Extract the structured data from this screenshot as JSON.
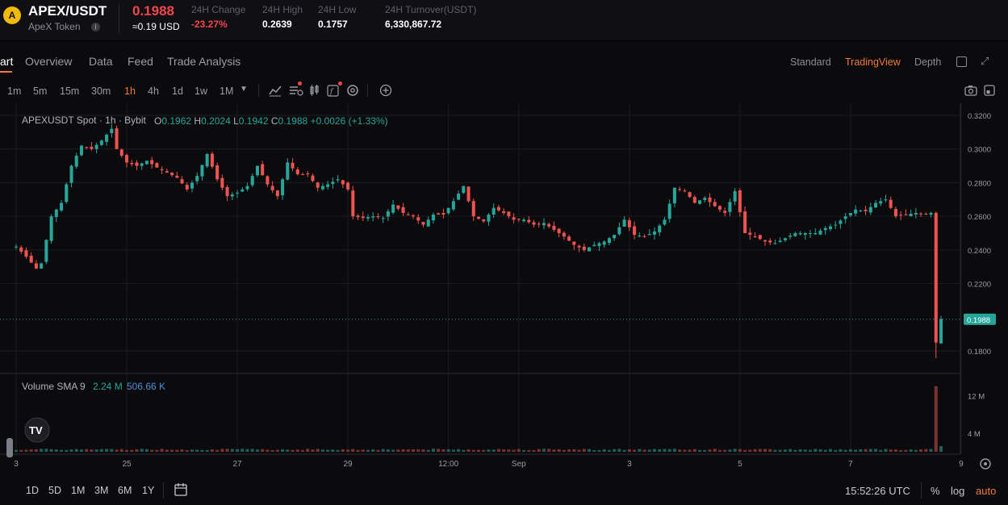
{
  "ticker": {
    "logo_glyph": "A",
    "pair": "APEX/USDT",
    "token_name": "ApeX Token",
    "info_glyph": "i",
    "price": "0.1988",
    "price_usd": "≈0.19 USD",
    "stats": [
      {
        "label": "24H Change",
        "value": "-23.27%",
        "negative": true
      },
      {
        "label": "24H High",
        "value": "0.2639",
        "negative": false
      },
      {
        "label": "24H Low",
        "value": "0.1757",
        "negative": false
      },
      {
        "label": "24H Turnover(USDT)",
        "value": "6,330,867.72",
        "negative": false
      }
    ]
  },
  "tabs": [
    "art",
    "Overview",
    "Data",
    "Feed",
    "Trade Analysis"
  ],
  "views": [
    "Standard",
    "TradingView",
    "Depth"
  ],
  "active_view": "TradingView",
  "timeframes": [
    "1m",
    "5m",
    "15m",
    "30m",
    "1h",
    "4h",
    "1d",
    "1w",
    "1M"
  ],
  "active_timeframe": "1h",
  "toolbar_icons": [
    "indicators-icon",
    "compare-icon",
    "candle-type-icon",
    "function-icon",
    "settings-icon",
    "add-icon",
    "camera-icon",
    "fullscreen-icon"
  ],
  "legend": {
    "symbol": "APEXUSDT Spot · 1h · Bybit",
    "o_label": "O",
    "o": "0.1962",
    "h_label": "H",
    "h": "0.2024",
    "l_label": "L",
    "l": "0.1942",
    "c_label": "C",
    "c": "0.1988",
    "change": "+0.0026 (+1.33%)"
  },
  "volume_legend": {
    "label": "Volume SMA 9",
    "v1": "2.24 M",
    "v2": "506.66 K"
  },
  "colors": {
    "up": "#26a69a",
    "down": "#ef5350",
    "accent": "#f07a3a",
    "grid": "#1c1c22",
    "price_tag": "#26a69a",
    "volume_sma": "#4a90d9"
  },
  "bottom": {
    "ranges": [
      "1D",
      "5D",
      "1M",
      "3M",
      "6M",
      "1Y"
    ],
    "time": "15:52:26 UTC",
    "percent": "%",
    "log": "log",
    "auto": "auto"
  },
  "chart_data": {
    "type": "candlestick",
    "symbol": "APEXUSDT",
    "interval": "1h",
    "y_ticks": [
      0.32,
      0.3,
      0.28,
      0.26,
      0.24,
      0.22,
      0.18
    ],
    "y_tick_labels": [
      "0.3200",
      "0.3000",
      "0.2800",
      "0.2600",
      "0.2400",
      "0.2200",
      "0.1800"
    ],
    "ylim": [
      0.175,
      0.322
    ],
    "current_price": 0.1988,
    "current_price_label": "0.1988",
    "x_tick_labels": [
      "3",
      "25",
      "27",
      "29",
      "12:00",
      "Sep",
      "3",
      "5",
      "7",
      "9"
    ],
    "x_tick_index": [
      0,
      22,
      44,
      66,
      86,
      100,
      122,
      144,
      166,
      188
    ],
    "volume_ticks": [
      "12 M",
      "4 M"
    ],
    "volume_tick_values": [
      12,
      4
    ],
    "volume_max": 15,
    "close_path": [
      [
        0,
        0.242
      ],
      [
        2,
        0.236
      ],
      [
        4,
        0.229
      ],
      [
        5,
        0.232
      ],
      [
        7,
        0.26
      ],
      [
        9,
        0.268
      ],
      [
        11,
        0.29
      ],
      [
        13,
        0.302
      ],
      [
        15,
        0.3
      ],
      [
        17,
        0.305
      ],
      [
        19,
        0.312
      ],
      [
        20,
        0.3
      ],
      [
        22,
        0.292
      ],
      [
        24,
        0.29
      ],
      [
        26,
        0.293
      ],
      [
        28,
        0.289
      ],
      [
        30,
        0.286
      ],
      [
        32,
        0.283
      ],
      [
        34,
        0.276
      ],
      [
        36,
        0.284
      ],
      [
        38,
        0.297
      ],
      [
        40,
        0.282
      ],
      [
        42,
        0.272
      ],
      [
        44,
        0.274
      ],
      [
        46,
        0.278
      ],
      [
        48,
        0.29
      ],
      [
        50,
        0.279
      ],
      [
        52,
        0.272
      ],
      [
        54,
        0.292
      ],
      [
        56,
        0.285
      ],
      [
        58,
        0.285
      ],
      [
        60,
        0.277
      ],
      [
        62,
        0.279
      ],
      [
        64,
        0.282
      ],
      [
        66,
        0.276
      ],
      [
        67,
        0.26
      ],
      [
        69,
        0.259
      ],
      [
        71,
        0.26
      ],
      [
        73,
        0.259
      ],
      [
        75,
        0.267
      ],
      [
        77,
        0.262
      ],
      [
        79,
        0.26
      ],
      [
        81,
        0.255
      ],
      [
        83,
        0.261
      ],
      [
        85,
        0.261
      ],
      [
        87,
        0.269
      ],
      [
        89,
        0.278
      ],
      [
        91,
        0.26
      ],
      [
        93,
        0.257
      ],
      [
        95,
        0.265
      ],
      [
        97,
        0.262
      ],
      [
        99,
        0.258
      ],
      [
        101,
        0.258
      ],
      [
        103,
        0.255
      ],
      [
        105,
        0.256
      ],
      [
        107,
        0.252
      ],
      [
        109,
        0.248
      ],
      [
        111,
        0.243
      ],
      [
        113,
        0.24
      ],
      [
        115,
        0.243
      ],
      [
        117,
        0.245
      ],
      [
        119,
        0.249
      ],
      [
        121,
        0.258
      ],
      [
        123,
        0.249
      ],
      [
        125,
        0.248
      ],
      [
        127,
        0.251
      ],
      [
        129,
        0.258
      ],
      [
        131,
        0.277
      ],
      [
        133,
        0.275
      ],
      [
        135,
        0.268
      ],
      [
        137,
        0.271
      ],
      [
        139,
        0.266
      ],
      [
        141,
        0.262
      ],
      [
        143,
        0.275
      ],
      [
        145,
        0.25
      ],
      [
        147,
        0.248
      ],
      [
        149,
        0.245
      ],
      [
        151,
        0.244
      ],
      [
        153,
        0.247
      ],
      [
        155,
        0.25
      ],
      [
        157,
        0.25
      ],
      [
        159,
        0.25
      ],
      [
        161,
        0.253
      ],
      [
        163,
        0.255
      ],
      [
        165,
        0.26
      ],
      [
        167,
        0.264
      ],
      [
        169,
        0.263
      ],
      [
        171,
        0.268
      ],
      [
        173,
        0.27
      ],
      [
        175,
        0.26
      ],
      [
        177,
        0.261
      ],
      [
        179,
        0.262
      ],
      [
        181,
        0.261
      ],
      [
        182,
        0.262
      ],
      [
        183,
        0.185
      ],
      [
        184,
        0.199
      ]
    ],
    "low_wick": {
      "index": 183,
      "low": 0.1757
    }
  }
}
